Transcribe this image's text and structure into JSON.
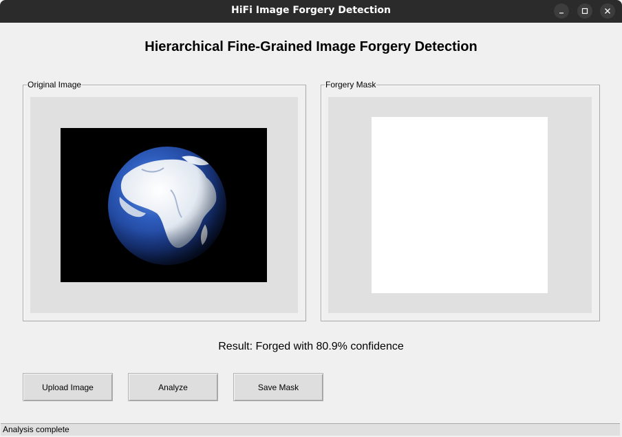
{
  "window": {
    "title": "HiFi Image Forgery Detection",
    "controls": {
      "minimize_icon": "minimize-icon",
      "maximize_icon": "maximize-icon",
      "close_icon": "close-icon"
    }
  },
  "heading": "Hierarchical Fine-Grained Image Forgery Detection",
  "panels": {
    "original": {
      "label": "Original Image",
      "image": "earth-globe-photo"
    },
    "mask": {
      "label": "Forgery Mask",
      "image": "white-mask"
    }
  },
  "result": "Result: Forged with 80.9% confidence",
  "buttons": {
    "upload": "Upload Image",
    "analyze": "Analyze",
    "save": "Save Mask"
  },
  "status": "Analysis complete",
  "colors": {
    "titlebar": "#2b2b2b",
    "background": "#f0f0f0",
    "canvas": "#e0e0e0",
    "button": "#dedede"
  }
}
